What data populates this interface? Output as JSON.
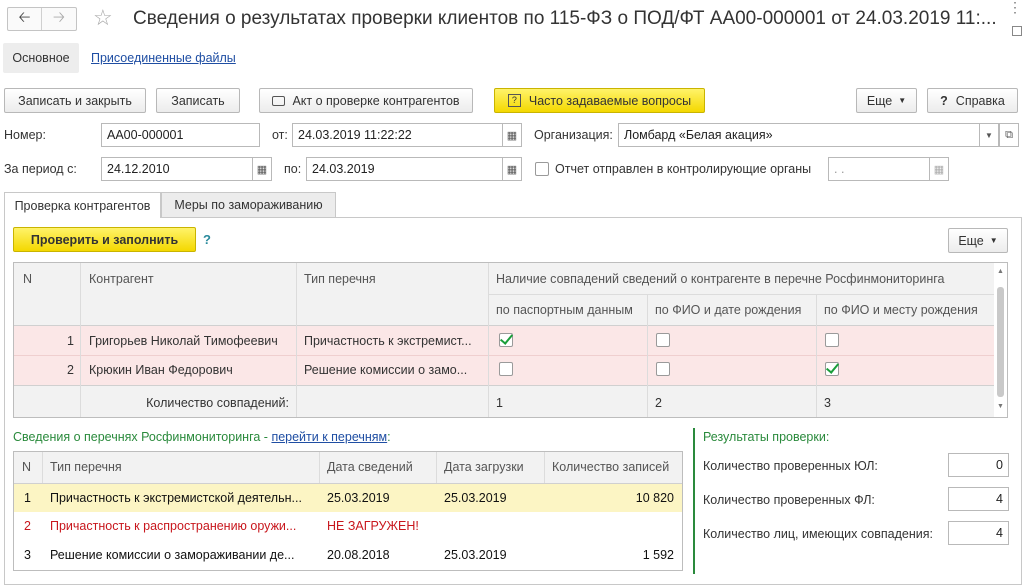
{
  "window": {
    "title": "Сведения о результатах проверки клиентов по 115-ФЗ о ПОД/ФТ АА00-000001 от 24.03.2019 11:...",
    "back_icon": "arrow-left-icon",
    "forward_icon": "arrow-right-icon",
    "star_icon": "star-icon",
    "more_icon": "kebab-icon",
    "restore_icon": "restore-window-icon",
    "close_icon": "close-icon"
  },
  "nav": {
    "tab_main": "Основное",
    "tab_files": "Присоединенные файлы"
  },
  "toolbar": {
    "save_close": "Записать и закрыть",
    "save": "Записать",
    "act": "Акт о проверке контрагентов",
    "faq": "Часто задаваемые вопросы",
    "more": "Еще",
    "help": "Справка"
  },
  "form": {
    "number_label": "Номер:",
    "number_value": "АА00-000001",
    "from_label": "от:",
    "from_value": "24.03.2019 11:22:22",
    "org_label": "Организация:",
    "org_value": "Ломбард «Белая акация»",
    "period_label": "За период с:",
    "period_from": "24.12.2010",
    "period_to_label": "по:",
    "period_to": "24.03.2019",
    "report_sent_label": "Отчет отправлен в контролирующие органы",
    "report_sent_date": " .  .",
    "report_sent_checked": false
  },
  "tabs": {
    "tab1": "Проверка контрагентов",
    "tab2": "Меры по замораживанию"
  },
  "check": {
    "fill_button": "Проверить и заполнить",
    "help_mark": "?",
    "more": "Еще"
  },
  "grid1": {
    "col_n": "N",
    "col_counterparty": "Контрагент",
    "col_list_type": "Тип перечня",
    "col_group": "Наличие совпадений сведений о контрагенте в перечне Росфинмониторинга",
    "col_passport": "по паспортным данным",
    "col_fio_birth": "по ФИО и дате рождения",
    "col_fio_place": "по ФИО и месту рождения",
    "rows": [
      {
        "n": "1",
        "name": "Григорьев Николай Тимофеевич",
        "type": "Причастность к экстремист...",
        "passport": true,
        "fio_birth": false,
        "fio_place": false
      },
      {
        "n": "2",
        "name": "Крюкин Иван Федорович",
        "type": "Решение комиссии о замо...",
        "passport": false,
        "fio_birth": false,
        "fio_place": true
      }
    ],
    "footer_label": "Количество совпадений:",
    "footer_passport": "1",
    "footer_fio_birth": "2",
    "footer_fio_place": "3"
  },
  "lists": {
    "caption": "Сведения о перечнях Росфинмониторинга - ",
    "link": "перейти к перечням",
    "colon": ":",
    "col_n": "N",
    "col_type": "Тип перечня",
    "col_info_date": "Дата сведений",
    "col_load_date": "Дата загрузки",
    "col_count": "Количество записей",
    "rows": [
      {
        "n": "1",
        "type": "Причастность к экстремистской деятельн...",
        "info_date": "25.03.2019",
        "load_date": "25.03.2019",
        "count": "10 820"
      },
      {
        "n": "2",
        "type": "Причастность к распространению оружи...",
        "info_date": "НЕ ЗАГРУЖЕН!",
        "load_date": "",
        "count": ""
      },
      {
        "n": "3",
        "type": "Решение комиссии о замораживании де...",
        "info_date": "20.08.2018",
        "load_date": "25.03.2019",
        "count": "1 592"
      }
    ]
  },
  "results": {
    "title": "Результаты проверки:",
    "ul_label": "Количество проверенных ЮЛ:",
    "ul_value": "0",
    "fl_label": "Количество проверенных ФЛ:",
    "fl_value": "4",
    "match_label": "Количество лиц, имеющих совпадения:",
    "match_value": "4"
  },
  "colors": {
    "highlight_row": "#fbe7e7",
    "selected_row": "#fcf5c4",
    "accent_green": "#2a8a3c",
    "link_blue": "#1f4ea3",
    "error_red": "#c8171d",
    "yellow_button": "#f4d800"
  }
}
